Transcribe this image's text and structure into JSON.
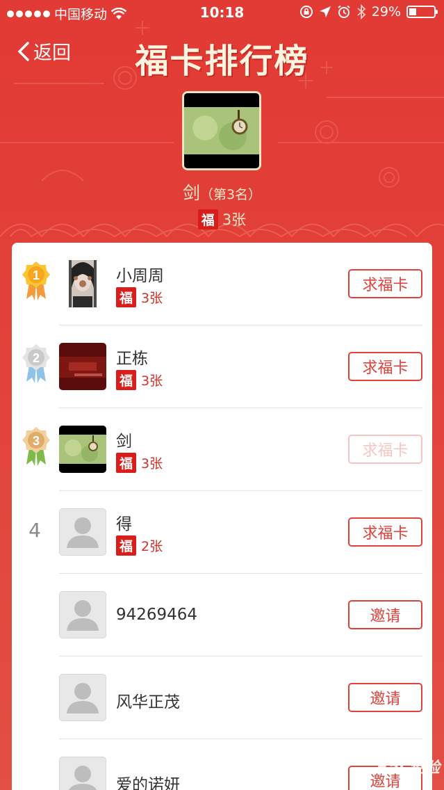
{
  "status_bar": {
    "carrier": "中国移动",
    "time": "10:18",
    "battery": "29%",
    "battery_level": 0.29
  },
  "nav": {
    "back_label": "返回",
    "title": "福卡排行榜"
  },
  "me": {
    "name": "剑",
    "rank_text": "（第3名）",
    "count": "3张"
  },
  "fu_char": "福",
  "list": [
    {
      "rank": "1",
      "name": "小周周",
      "count": "3张",
      "button": "求福卡",
      "button_enabled": true,
      "avatar": "photo-girl",
      "medal": "gold-medal"
    },
    {
      "rank": "2",
      "name": "正栋",
      "count": "3张",
      "button": "求福卡",
      "button_enabled": true,
      "avatar": "photo-dark-red",
      "medal": "silver-medal"
    },
    {
      "rank": "3",
      "name": "剑",
      "count": "3张",
      "button": "求福卡",
      "button_enabled": false,
      "avatar": "photo-clock",
      "medal": "bronze-medal"
    },
    {
      "rank": "4",
      "name": "得",
      "count": "2张",
      "button": "求福卡",
      "button_enabled": true,
      "avatar": "default-avatar"
    },
    {
      "name": "94269464",
      "button": "邀请",
      "button_enabled": true,
      "avatar": "default-avatar"
    },
    {
      "name": "风华正茂",
      "button": "邀请",
      "button_enabled": true,
      "avatar": "default-avatar"
    },
    {
      "name": "爱的诺妍",
      "button": "邀请",
      "button_enabled": true,
      "avatar": "default-avatar"
    }
  ],
  "watermark": "Bai 经验",
  "colors": {
    "background": "#e23a34",
    "accent": "#e0413a",
    "fu_badge": "#d81e1a"
  }
}
